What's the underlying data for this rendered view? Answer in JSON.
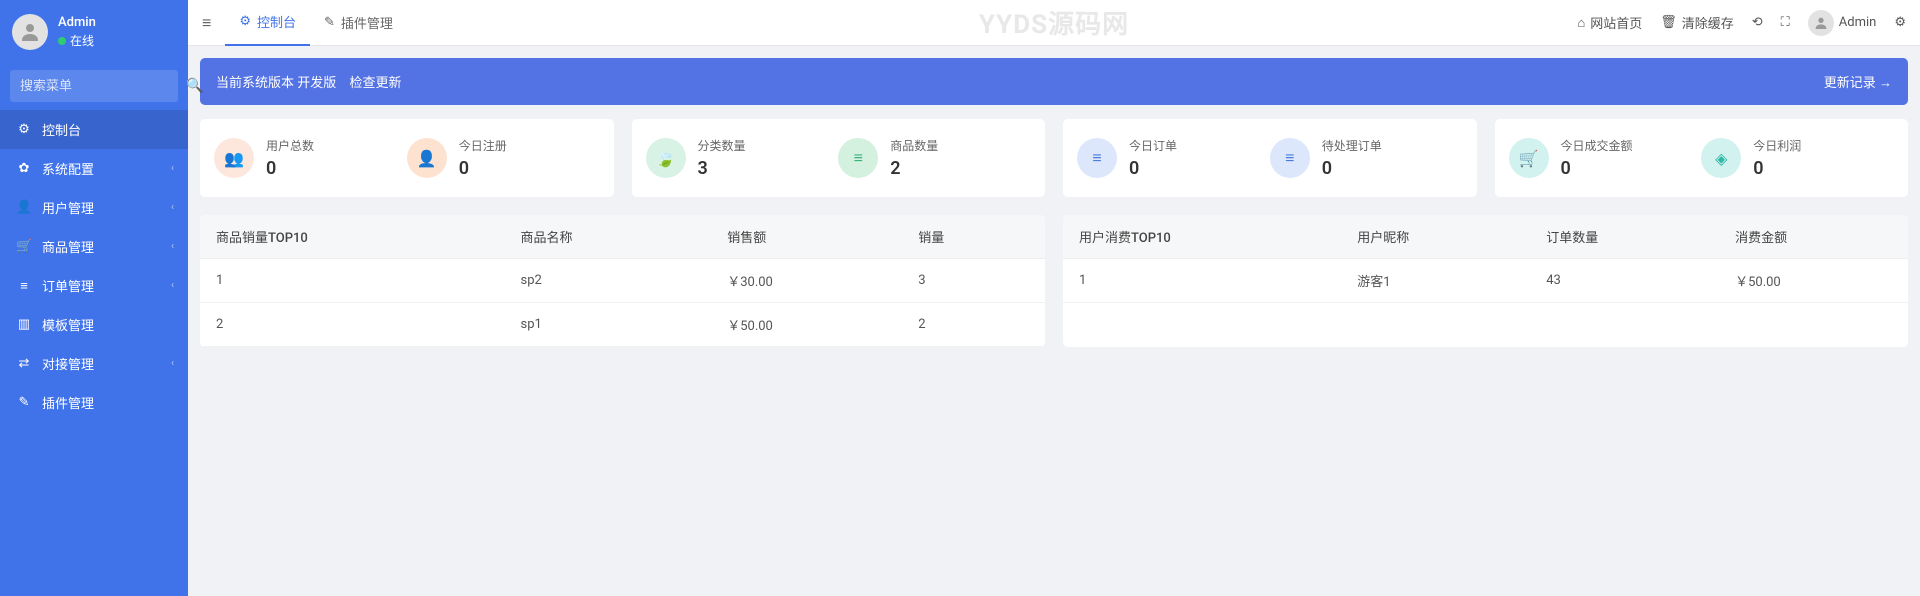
{
  "user": {
    "name": "Admin",
    "status": "在线"
  },
  "search": {
    "placeholder": "搜索菜单"
  },
  "menu": [
    {
      "icon": "⚙",
      "label": "控制台",
      "active": true,
      "expand": false
    },
    {
      "icon": "✿",
      "label": "系统配置",
      "active": false,
      "expand": true
    },
    {
      "icon": "👤",
      "label": "用户管理",
      "active": false,
      "expand": true
    },
    {
      "icon": "🛒",
      "label": "商品管理",
      "active": false,
      "expand": true
    },
    {
      "icon": "≡",
      "label": "订单管理",
      "active": false,
      "expand": true
    },
    {
      "icon": "▥",
      "label": "模板管理",
      "active": false,
      "expand": false
    },
    {
      "icon": "⇄",
      "label": "对接管理",
      "active": false,
      "expand": true
    },
    {
      "icon": "✎",
      "label": "插件管理",
      "active": false,
      "expand": false
    }
  ],
  "tabs": [
    {
      "icon": "⚙",
      "label": "控制台",
      "active": true
    },
    {
      "icon": "✎",
      "label": "插件管理",
      "active": false
    }
  ],
  "watermark": "YYDS源码网",
  "topbar_right": {
    "home": "网站首页",
    "clear": "清除缓存",
    "user": "Admin"
  },
  "banner": {
    "version_prefix": "当前系统版本",
    "version_value": "开发版",
    "check": "检查更新",
    "changelog": "更新记录 →"
  },
  "stats": [
    {
      "icon": "👥",
      "label": "用户总数",
      "value": "0",
      "cls": "ic-orange"
    },
    {
      "icon": "👤",
      "label": "今日注册",
      "value": "0",
      "cls": "ic-orange2"
    },
    {
      "icon": "🍃",
      "label": "分类数量",
      "value": "3",
      "cls": "ic-green"
    },
    {
      "icon": "≡",
      "label": "商品数量",
      "value": "2",
      "cls": "ic-green2"
    },
    {
      "icon": "≡",
      "label": "今日订单",
      "value": "0",
      "cls": "ic-blue"
    },
    {
      "icon": "≡",
      "label": "待处理订单",
      "value": "0",
      "cls": "ic-blue2"
    },
    {
      "icon": "🛒",
      "label": "今日成交金额",
      "value": "0",
      "cls": "ic-teal"
    },
    {
      "icon": "◈",
      "label": "今日利润",
      "value": "0",
      "cls": "ic-teal2"
    }
  ],
  "table1": {
    "headers": [
      "商品销量TOP10",
      "商品名称",
      "销售额",
      "销量"
    ],
    "rows": [
      [
        "1",
        "sp2",
        "￥30.00",
        "3"
      ],
      [
        "2",
        "sp1",
        "￥50.00",
        "2"
      ]
    ]
  },
  "table2": {
    "headers": [
      "用户消费TOP10",
      "用户昵称",
      "订单数量",
      "消费金额"
    ],
    "rows": [
      [
        "1",
        "游客1",
        "43",
        "￥50.00"
      ]
    ]
  }
}
